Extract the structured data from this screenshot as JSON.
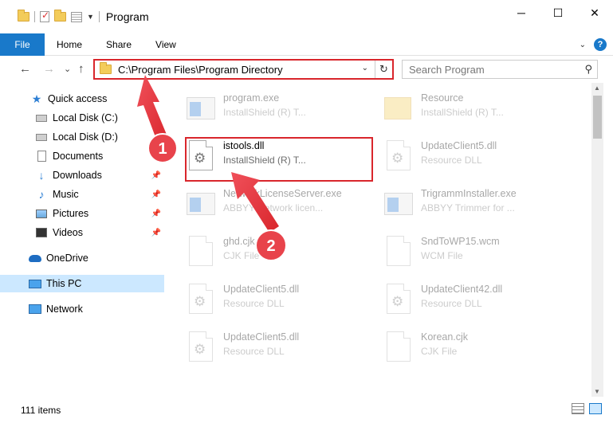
{
  "window": {
    "title": "Program",
    "minimize": "─",
    "maximize": "☐",
    "close": "✕"
  },
  "ribbon": {
    "file": "File",
    "tabs": [
      "Home",
      "Share",
      "View"
    ],
    "help": "?"
  },
  "nav": {
    "back": "←",
    "forward": "→",
    "recent": "⌄",
    "up": "↑",
    "address": "C:\\Program Files\\Program Directory",
    "refresh": "↻",
    "search_placeholder": "Search Program"
  },
  "sidebar": {
    "items": [
      {
        "label": "Quick access",
        "icon": "star-icon"
      },
      {
        "label": "Local Disk (C:)",
        "icon": "disk-icon"
      },
      {
        "label": "Local Disk (D:)",
        "icon": "disk-icon"
      },
      {
        "label": "Documents",
        "icon": "document-icon"
      },
      {
        "label": "Downloads",
        "icon": "download-icon",
        "pinned": true
      },
      {
        "label": "Music",
        "icon": "music-icon",
        "pinned": true
      },
      {
        "label": "Pictures",
        "icon": "pictures-icon",
        "pinned": true
      },
      {
        "label": "Videos",
        "icon": "videos-icon",
        "pinned": true
      },
      {
        "label": "OneDrive",
        "icon": "cloud-icon"
      },
      {
        "label": "This PC",
        "icon": "pc-icon",
        "selected": true
      },
      {
        "label": "Network",
        "icon": "network-icon"
      }
    ]
  },
  "files": [
    {
      "name": "program.exe",
      "desc": "InstallShield (R) T...",
      "icon": "app-icon",
      "faded": true
    },
    {
      "name": "Resource",
      "desc": "InstallShield (R) T...",
      "icon": "folder-icon",
      "faded": true
    },
    {
      "name": "istools.dll",
      "desc": "InstallShield (R) T...",
      "icon": "dll-icon",
      "faded": false
    },
    {
      "name": "UpdateClient5.dll",
      "desc": "Resource DLL",
      "icon": "dll-icon",
      "faded": true
    },
    {
      "name": "NetworkLicenseServer.exe",
      "desc": "ABBYY Network licen...",
      "icon": "app-icon",
      "faded": true
    },
    {
      "name": "TrigrammInstaller.exe",
      "desc": "ABBYY Trimmer for ...",
      "icon": "app-icon",
      "faded": true
    },
    {
      "name": "ghd.cjk",
      "desc": "CJK File",
      "icon": "file-icon",
      "faded": true
    },
    {
      "name": "SndToWP15.wcm",
      "desc": "WCM File",
      "icon": "file-icon",
      "faded": true
    },
    {
      "name": "UpdateClient5.dll",
      "desc": "Resource DLL",
      "icon": "dll-icon",
      "faded": true
    },
    {
      "name": "UpdateClient42.dll",
      "desc": "Resource DLL",
      "icon": "dll-icon",
      "faded": true
    },
    {
      "name": "UpdateClient5.dll",
      "desc": "Resource DLL",
      "icon": "dll-icon",
      "faded": true
    },
    {
      "name": "Korean.cjk",
      "desc": "CJK File",
      "icon": "file-icon",
      "faded": true
    }
  ],
  "callouts": {
    "one": "1",
    "two": "2"
  },
  "status": {
    "items": "111 items"
  },
  "colors": {
    "accent": "#1979ca",
    "highlight": "#d9262c",
    "selected": "#cce8ff"
  }
}
